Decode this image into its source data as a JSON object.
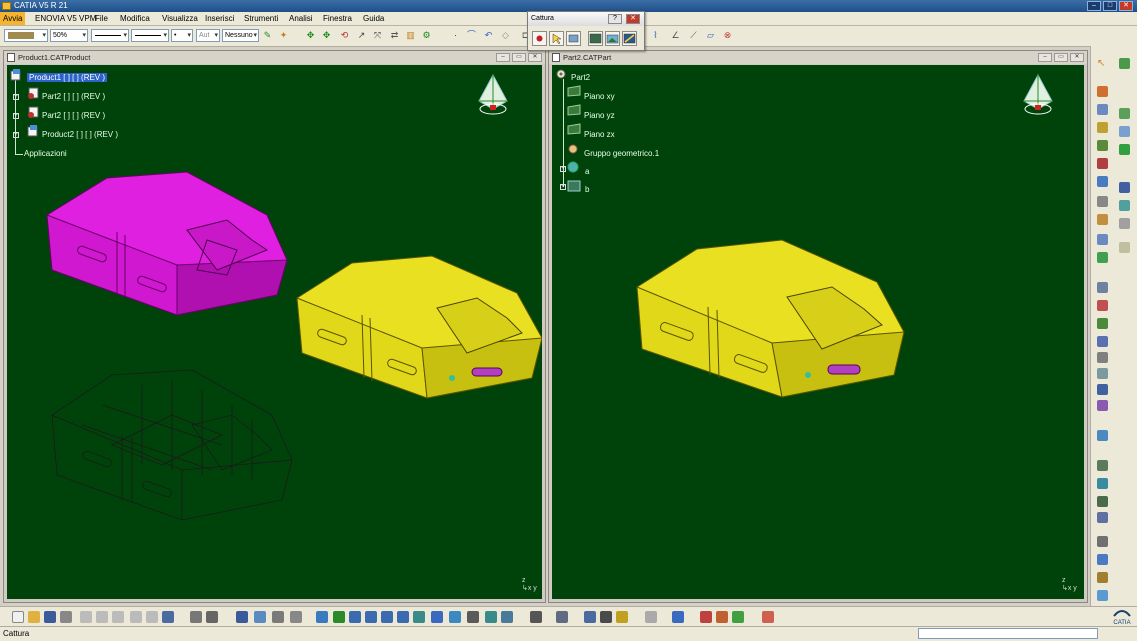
{
  "window": {
    "title": "CATIA V5 R 21"
  },
  "menu": [
    "Avvia",
    "ENOVIA V5 VPM",
    "File",
    "Modifica",
    "Visualizza",
    "Inserisci",
    "Strumenti",
    "Analisi",
    "Finestra",
    "Guida"
  ],
  "toolbar": {
    "color": "#a08a50",
    "zoom": "50%",
    "auto": "Aut",
    "layer": "Nessuno"
  },
  "capture_dialog": {
    "title": "Cattura",
    "help": "?",
    "close": "✕"
  },
  "left_view": {
    "title": "Product1.CATProduct",
    "tree": [
      {
        "label": "Product1 [ ] [ ] (REV )"
      },
      {
        "label": "Part2 [ ] [ ] (REV )"
      },
      {
        "label": "Part2 [ ] [ ] (REV )"
      },
      {
        "label": "Product2 [ ] [ ] (REV )"
      },
      {
        "label": "Applicazioni"
      }
    ]
  },
  "right_view": {
    "title": "Part2.CATPart",
    "tree": [
      {
        "label": "Part2"
      },
      {
        "label": "Piano xy"
      },
      {
        "label": "Piano yz"
      },
      {
        "label": "Piano zx"
      },
      {
        "label": "Gruppo geometrico.1"
      },
      {
        "label": "a"
      },
      {
        "label": "b"
      }
    ]
  },
  "colors": {
    "background": "#00430a",
    "magenta_part": "#e020e0",
    "yellow_part": "#e8e020",
    "accent_menu": "#f4b430"
  },
  "status": {
    "text": "Cattura"
  },
  "brand": "CATIA"
}
